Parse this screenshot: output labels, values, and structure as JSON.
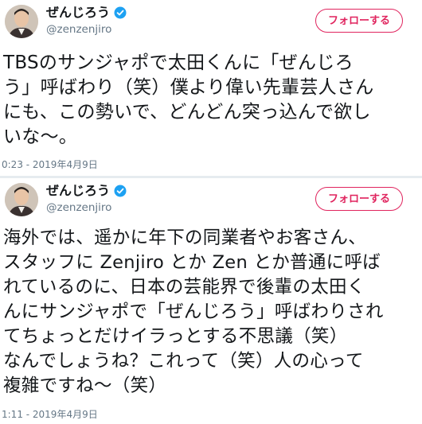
{
  "tweets": [
    {
      "author_name": "ぜんじろう",
      "author_handle": "@zenzenjiro",
      "follow_label": "フォローする",
      "text_lines": [
        "TBSのサンジャポで太田くんに「ぜんじろ",
        "う」呼ばわり（笑）僕より偉い先輩芸人さん",
        "にも、この勢いで、どんどん突っ込んで欲し",
        "いな〜。"
      ],
      "timestamp": "0:23 - 2019年4月9日"
    },
    {
      "author_name": "ぜんじろう",
      "author_handle": "@zenzenjiro",
      "follow_label": "フォローする",
      "text_lines": [
        "海外では、遥かに年下の同業者やお客さん、",
        "スタッフに Zenjiro とか Zen とか普通に呼ば",
        "れているのに、日本の芸能界で後輩の太田く",
        "んにサンジャポで「ぜんじろう」呼ばわりされ",
        "てちょっとだけイラっとする不思議（笑）",
        "なんでしょうね？これって（笑）人の心って",
        "複雑ですね〜（笑）"
      ],
      "timestamp": "1:11 - 2019年4月9日"
    }
  ],
  "icons": {
    "verified": "verified-badge-icon",
    "avatar": "avatar-photo"
  },
  "colors": {
    "follow_accent": "#e0245e",
    "verified_blue": "#1da1f2",
    "muted_text": "#657786"
  }
}
